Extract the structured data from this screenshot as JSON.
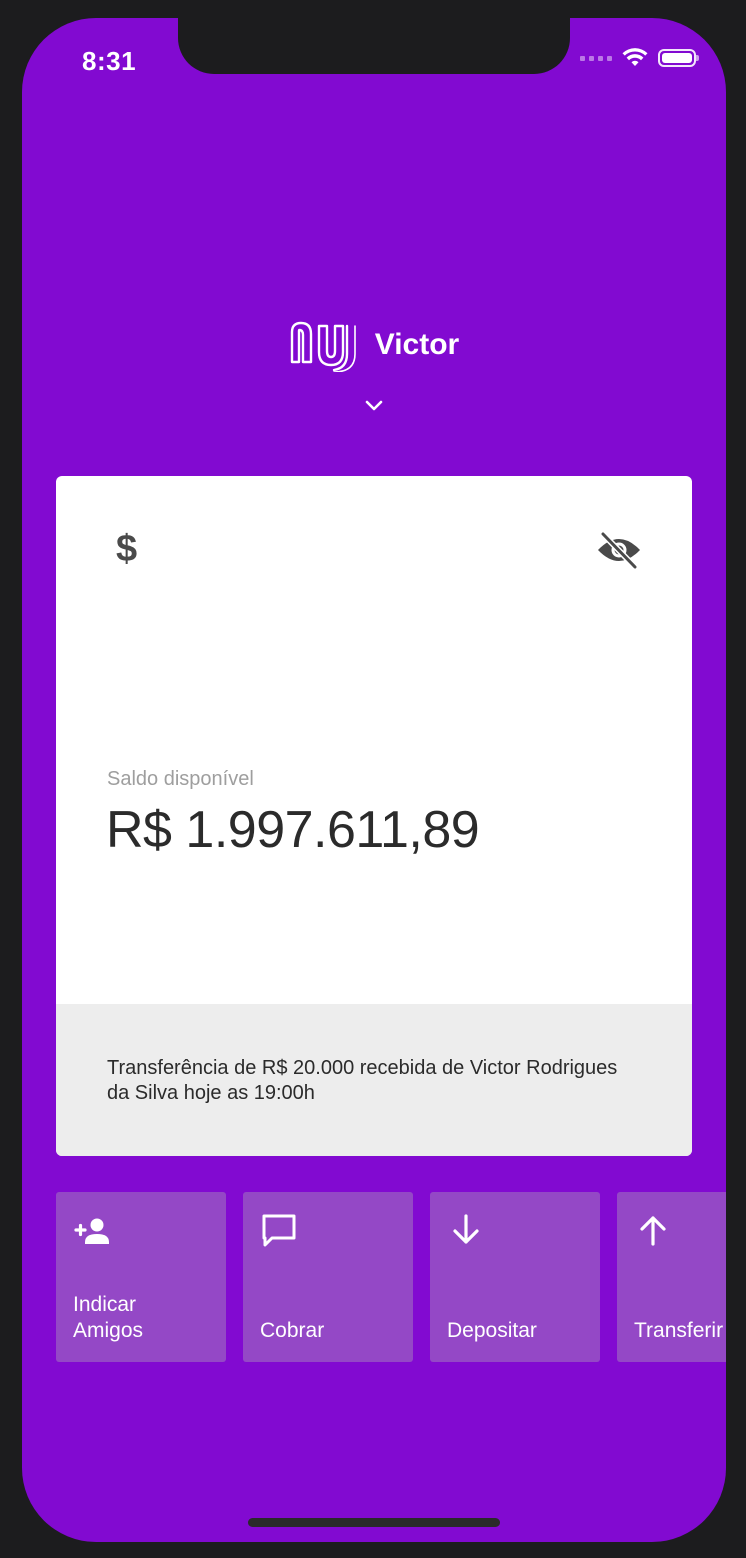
{
  "status_bar": {
    "time": "8:31"
  },
  "header": {
    "logo_icon": "nubank-logo-icon",
    "user_name": "Victor",
    "chevron_icon": "chevron-down-icon"
  },
  "balance_card": {
    "currency_icon": "dollar-icon",
    "visibility_icon": "eye-off-icon",
    "label": "Saldo disponível",
    "value": "R$ 1.997.611,89",
    "footer_message": "Transferência de R$ 20.000 recebida de Victor Rodrigues da Silva hoje as 19:00h"
  },
  "actions": [
    {
      "label": "Indicar\nAmigos",
      "icon": "person-add-icon"
    },
    {
      "label": "Cobrar",
      "icon": "chat-bubble-icon"
    },
    {
      "label": "Depositar",
      "icon": "arrow-down-icon"
    },
    {
      "label": "Transferir",
      "icon": "arrow-up-icon"
    }
  ],
  "colors": {
    "brand_purple": "#820ad1",
    "action_tile": "#9448c6",
    "card_footer": "#ededed",
    "device_frame": "#1c1c1e"
  }
}
